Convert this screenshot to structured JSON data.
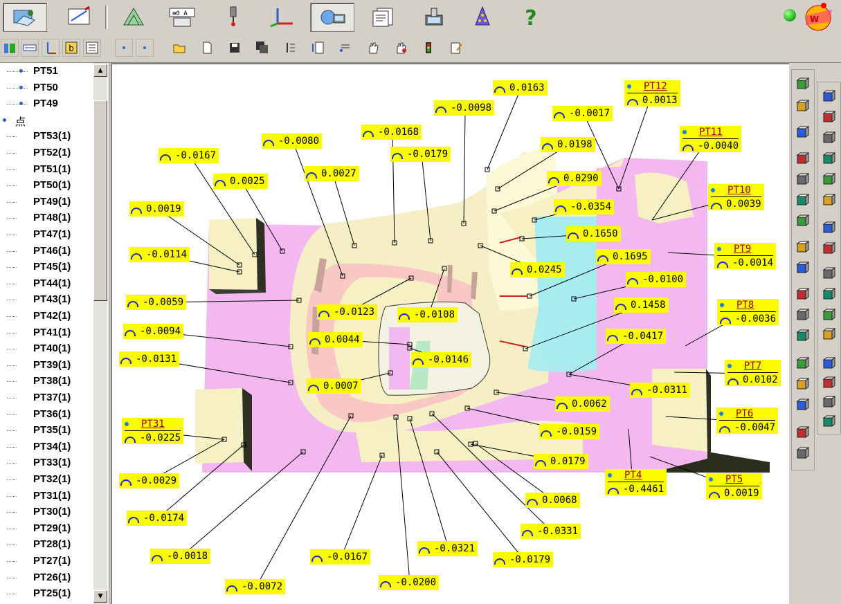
{
  "tree": {
    "items": [
      {
        "label": "PT51",
        "top": true
      },
      {
        "label": "PT50",
        "top": true
      },
      {
        "label": "PT49",
        "top": true
      },
      {
        "label": "点",
        "group": true
      },
      {
        "label": "PT53(1)"
      },
      {
        "label": "PT52(1)"
      },
      {
        "label": "PT51(1)"
      },
      {
        "label": "PT50(1)"
      },
      {
        "label": "PT49(1)"
      },
      {
        "label": "PT48(1)"
      },
      {
        "label": "PT47(1)"
      },
      {
        "label": "PT46(1)"
      },
      {
        "label": "PT45(1)"
      },
      {
        "label": "PT44(1)"
      },
      {
        "label": "PT43(1)"
      },
      {
        "label": "PT42(1)"
      },
      {
        "label": "PT41(1)"
      },
      {
        "label": "PT40(1)"
      },
      {
        "label": "PT39(1)"
      },
      {
        "label": "PT38(1)"
      },
      {
        "label": "PT37(1)"
      },
      {
        "label": "PT36(1)"
      },
      {
        "label": "PT35(1)"
      },
      {
        "label": "PT34(1)"
      },
      {
        "label": "PT33(1)"
      },
      {
        "label": "PT32(1)"
      },
      {
        "label": "PT31(1)"
      },
      {
        "label": "PT30(1)"
      },
      {
        "label": "PT29(1)"
      },
      {
        "label": "PT28(1)"
      },
      {
        "label": "PT27(1)"
      },
      {
        "label": "PT26(1)"
      },
      {
        "label": "PT25(1)"
      }
    ]
  },
  "deviations": [
    "0.0163",
    "-0.0098",
    "-0.0017",
    "-0.0168",
    "-0.0080",
    "-0.0179",
    "-0.0167",
    "0.0198",
    "0.0027",
    "0.0025",
    "0.0290",
    "-0.0354",
    "0.0019",
    "0.1650",
    "-0.0114",
    "0.0245",
    "0.1695",
    "-0.0100",
    "-0.0059",
    "-0.0123",
    "-0.0108",
    "0.1458",
    "-0.0094",
    "-0.0417",
    "0.0044",
    "-0.0146",
    "-0.0131",
    "0.0007",
    "-0.0311",
    "0.0062",
    "-0.0159",
    "0.0179",
    "-0.0029",
    "0.0068",
    "-0.0174",
    "-0.0331",
    "-0.0018",
    "-0.0167",
    "-0.0321",
    "-0.0179",
    "-0.0072",
    "-0.0200"
  ],
  "points": [
    {
      "name": "PT12",
      "value": "0.0013"
    },
    {
      "name": "PT11",
      "value": "-0.0040"
    },
    {
      "name": "PT10",
      "value": "0.0039"
    },
    {
      "name": "PT9",
      "value": "-0.0014"
    },
    {
      "name": "PT8",
      "value": "-0.0036"
    },
    {
      "name": "PT7",
      "value": "0.0102"
    },
    {
      "name": "PT6",
      "value": "-0.0047"
    },
    {
      "name": "PT5",
      "value": "0.0019"
    },
    {
      "name": "PT4",
      "value": "-0.4461"
    },
    {
      "name": "PT31",
      "value": "-0.0225"
    }
  ],
  "toolbar": {
    "main_buttons": [
      "model-icon",
      "sketch-icon",
      "geometry-icon",
      "dimension-icon",
      "probe-icon",
      "coordinate-icon",
      "cmm-icon",
      "report-icon",
      "calibration-icon",
      "wizard-icon",
      "help-icon"
    ],
    "status_color": "#22b822"
  },
  "colors": {
    "tag_bg": "#fcfc00",
    "arc": "#1d2fb8",
    "pink": "#f4b8f0",
    "cream": "#f6f0c4"
  }
}
